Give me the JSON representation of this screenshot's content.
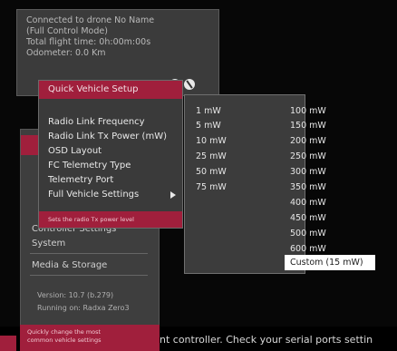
{
  "status": {
    "line1": "Connected to drone No Name",
    "line2": "(Full Control Mode)",
    "line3": "Total flight time: 0h:00m:00s",
    "line4": "Odometer: 0.0 Km"
  },
  "main_menu": {
    "items": [
      "Controller Settings",
      "System",
      "Media & Storage"
    ],
    "version": "Version: 10.7 (b.279)",
    "running": "Running on: Radxa Zero3",
    "hint_line1": "Quickly change the most",
    "hint_line2": "common vehicle settings"
  },
  "quick_menu": {
    "header": "Quick Vehicle Setup",
    "items": [
      "Radio Link Frequency",
      "Radio Link Tx Power (mW)",
      "OSD Layout",
      "FC Telemetry Type",
      "Telemetry Port",
      "Full Vehicle Settings"
    ],
    "hint": "Sets the radio Tx power level"
  },
  "power_menu": {
    "col1": [
      "1 mW",
      "5 mW",
      "10 mW",
      "25 mW",
      "50 mW",
      "75 mW"
    ],
    "col2": [
      "100 mW",
      "150 mW",
      "200 mW",
      "250 mW",
      "300 mW",
      "350 mW",
      "400 mW",
      "450 mW",
      "500 mW",
      "600 mW"
    ],
    "selected": "Custom (15 mW)"
  },
  "bottom": {
    "message": "nt controller. Check your serial ports settin"
  }
}
